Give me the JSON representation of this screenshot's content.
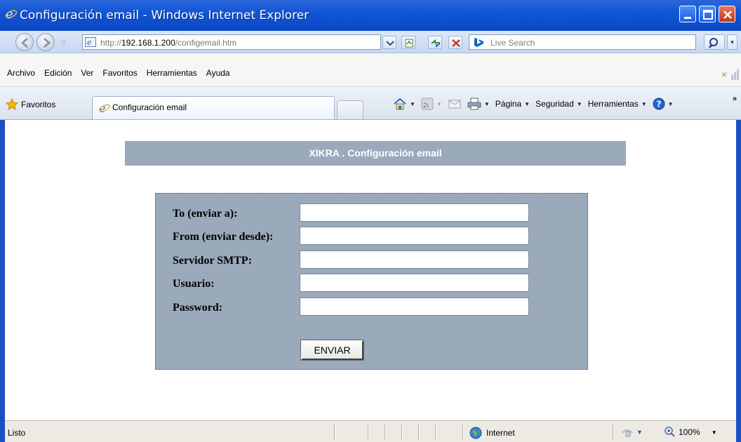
{
  "window": {
    "title": "Configuración email - Windows Internet Explorer"
  },
  "address": {
    "url_prefix": "http://",
    "url_host": "192.168.1.200",
    "url_path": "/configemail.htm"
  },
  "search": {
    "placeholder": "Live Search"
  },
  "menu": {
    "items": [
      "Archivo",
      "Edición",
      "Ver",
      "Favoritos",
      "Herramientas",
      "Ayuda"
    ]
  },
  "toolbar": {
    "favorites_label": "Favoritos",
    "tab_label": "Configuración email",
    "page_label": "Página",
    "security_label": "Seguridad",
    "tools_label": "Herramientas"
  },
  "page": {
    "heading": "XIKRA . Configuración email",
    "fields": [
      {
        "label": "To (enviar a):",
        "value": ""
      },
      {
        "label": "From (enviar desde):",
        "value": ""
      },
      {
        "label": "Servidor SMTP:",
        "value": ""
      },
      {
        "label": "Usuario:",
        "value": ""
      },
      {
        "label": "Password:",
        "value": ""
      }
    ],
    "submit_label": "ENVIAR"
  },
  "status": {
    "text": "Listo",
    "zone": "Internet",
    "zoom": "100%"
  },
  "colors": {
    "panel": "#9aaabb",
    "titlebar": "#0b47c4"
  }
}
